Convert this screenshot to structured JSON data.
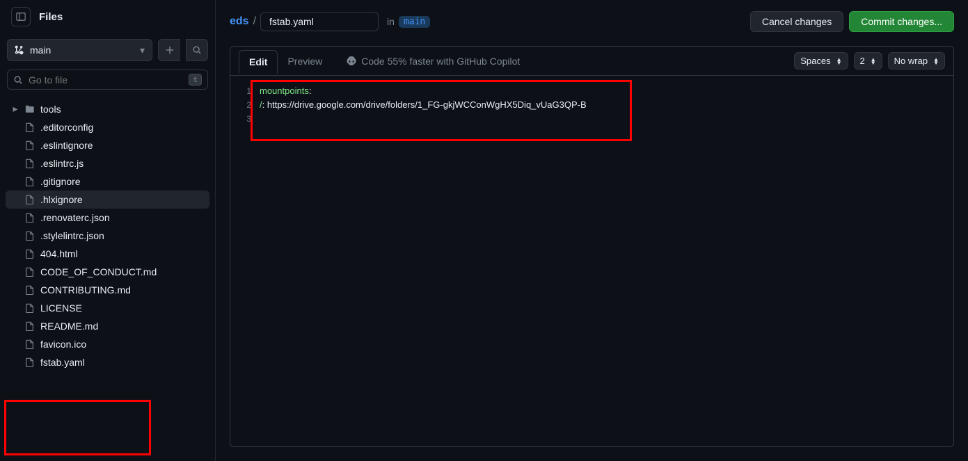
{
  "sidebar": {
    "title": "Files",
    "branch": "main",
    "search_placeholder": "Go to file",
    "search_kbd": "t",
    "tree": [
      {
        "type": "dir",
        "name": "tools",
        "chev": "right"
      },
      {
        "type": "file",
        "name": ".editorconfig"
      },
      {
        "type": "file",
        "name": ".eslintignore"
      },
      {
        "type": "file",
        "name": ".eslintrc.js"
      },
      {
        "type": "file",
        "name": ".gitignore"
      },
      {
        "type": "file",
        "name": ".hlxignore",
        "active": true
      },
      {
        "type": "file",
        "name": ".renovaterc.json"
      },
      {
        "type": "file",
        "name": ".stylelintrc.json"
      },
      {
        "type": "file",
        "name": "404.html"
      },
      {
        "type": "file",
        "name": "CODE_OF_CONDUCT.md"
      },
      {
        "type": "file",
        "name": "CONTRIBUTING.md"
      },
      {
        "type": "file",
        "name": "LICENSE"
      },
      {
        "type": "file",
        "name": "README.md"
      },
      {
        "type": "file",
        "name": "favicon.ico"
      },
      {
        "type": "file",
        "name": "fstab.yaml"
      }
    ]
  },
  "header": {
    "repo": "eds",
    "sep": "/",
    "filename": "fstab.yaml",
    "in": "in",
    "branch": "main",
    "cancel": "Cancel changes",
    "commit": "Commit changes..."
  },
  "tabs": {
    "edit": "Edit",
    "preview": "Preview",
    "copilot": "Code 55% faster with GitHub Copilot",
    "indent": "Spaces",
    "indentSize": "2",
    "wrap": "No wrap"
  },
  "code": {
    "l1_key": "mountpoints",
    "l1_punct": ":",
    "l2_indent": "  ",
    "l2_key": "/",
    "l2_punct": ": ",
    "l2_val": "https://drive.google.com/drive/folders/1_FG-gkjWCConWgHX5Diq_vUaG3QP-B",
    "lines": [
      "1",
      "2",
      "3"
    ]
  }
}
